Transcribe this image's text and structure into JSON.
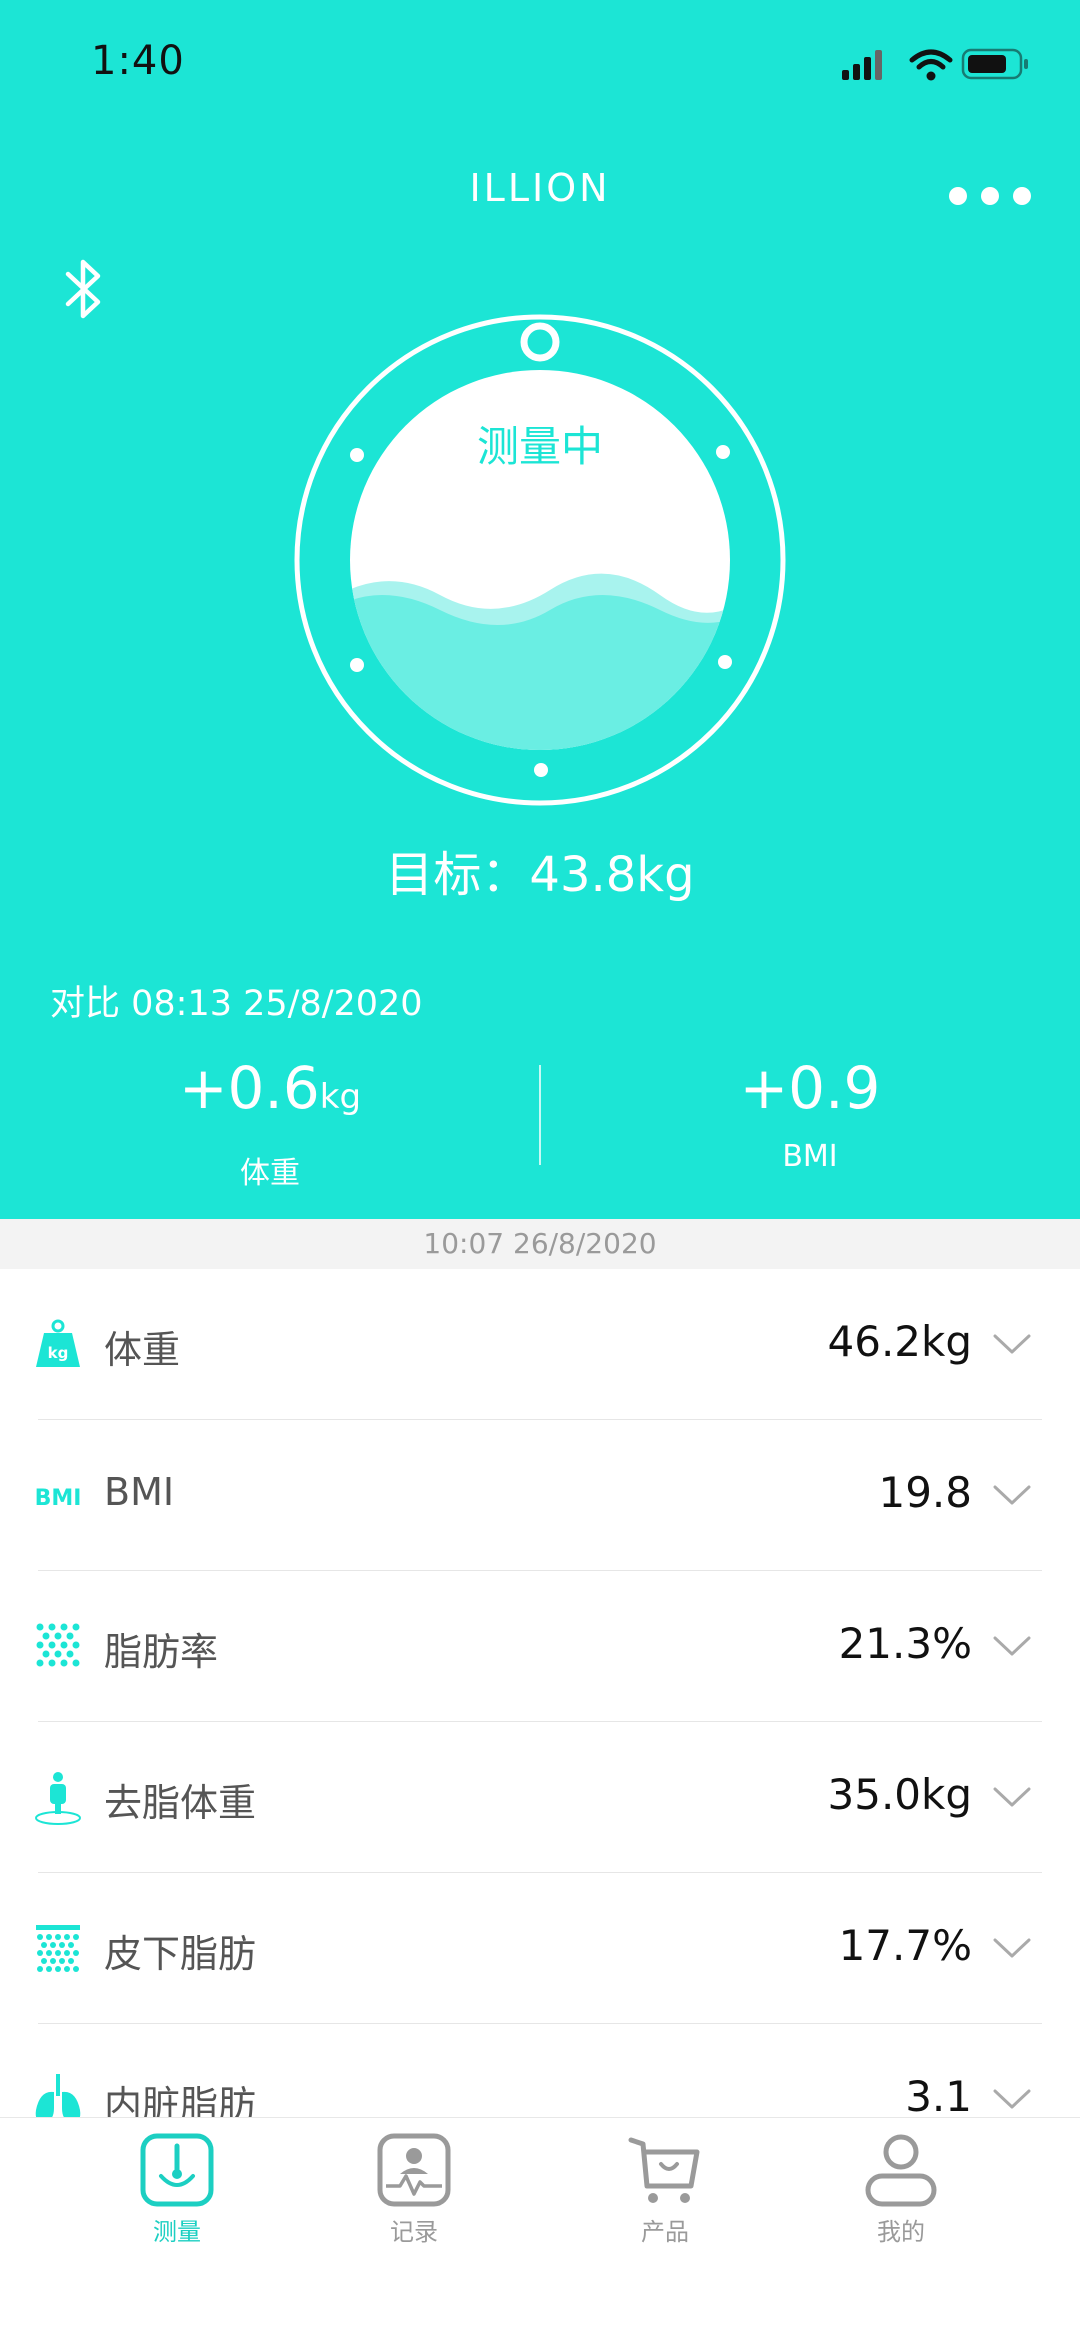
{
  "status_bar": {
    "time": "1:40"
  },
  "header": {
    "title": "ILLION",
    "more_icon": "more-dots-icon",
    "bluetooth_icon": "bluetooth-icon"
  },
  "gauge": {
    "status": "测量中",
    "target": "目标：43.8kg"
  },
  "comparison": {
    "label": "对比 08:13 25/8/2020",
    "weight": {
      "value": "+0.6",
      "unit": "kg",
      "label": "体重"
    },
    "bmi": {
      "value": "+0.9",
      "label": "BMI"
    }
  },
  "record_time": "10:07 26/8/2020",
  "metrics": [
    {
      "label": "体重",
      "value": "46.2kg",
      "icon": "weight-icon"
    },
    {
      "label": "BMI",
      "value": "19.8",
      "icon": "bmi-icon",
      "icon_text": "BMI"
    },
    {
      "label": "脂肪率",
      "value": "21.3%",
      "icon": "body-fat-icon"
    },
    {
      "label": "去脂体重",
      "value": "35.0kg",
      "icon": "lean-mass-icon"
    },
    {
      "label": "皮下脂肪",
      "value": "17.7%",
      "icon": "subcutaneous-fat-icon"
    },
    {
      "label": "内脏脂肪",
      "value": "3.1",
      "icon": "lungs-icon"
    }
  ],
  "tabs": [
    {
      "label": "测量",
      "icon": "measure-icon",
      "active": true
    },
    {
      "label": "记录",
      "icon": "record-icon",
      "active": false
    },
    {
      "label": "产品",
      "icon": "cart-icon",
      "active": false
    },
    {
      "label": "我的",
      "icon": "profile-icon",
      "active": false
    }
  ],
  "colors": {
    "accent": "#1ce5d5",
    "wave": "#6aeee3",
    "text_dark": "#111111",
    "text_muted": "#9a9a9a"
  }
}
